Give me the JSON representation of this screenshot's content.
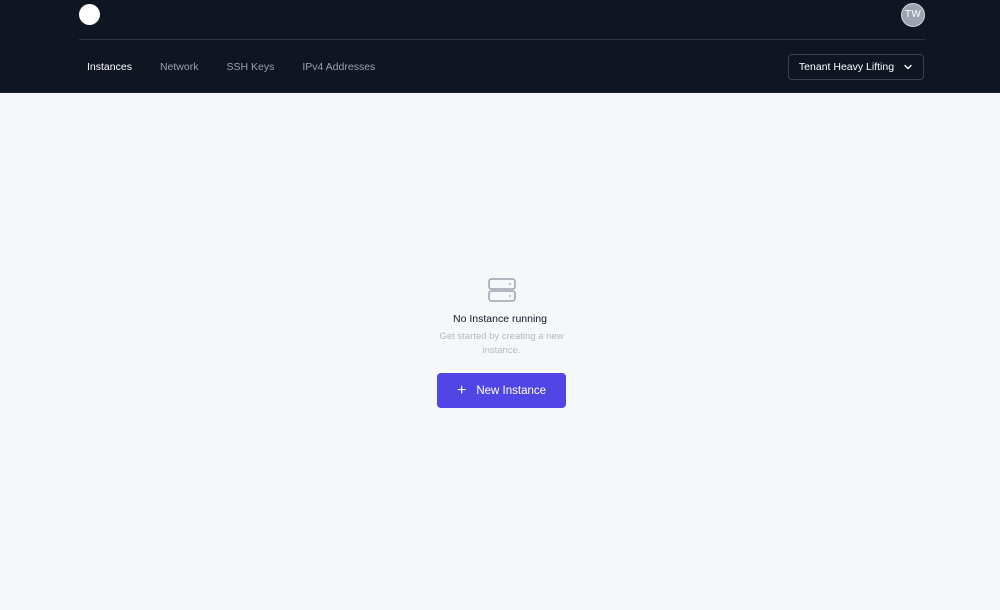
{
  "header": {
    "logo_icon": "circle-logo",
    "avatar_initials": "TW",
    "nav": [
      {
        "label": "Instances",
        "active": true
      },
      {
        "label": "Network",
        "active": false
      },
      {
        "label": "SSH Keys",
        "active": false
      },
      {
        "label": "IPv4 Addresses",
        "active": false
      }
    ],
    "tenant_label": "Tenant Heavy Lifting",
    "tenant_icon": "chevron-down-icon"
  },
  "empty_state": {
    "icon": "server-icon",
    "title": "No Instance running",
    "subtitle": "Get started by creating a new instance.",
    "button_label": "New Instance",
    "button_icon": "plus-icon"
  },
  "colors": {
    "header_bg": "#0f1521",
    "page_bg": "#f6f7f9",
    "accent": "#4f46e5"
  }
}
